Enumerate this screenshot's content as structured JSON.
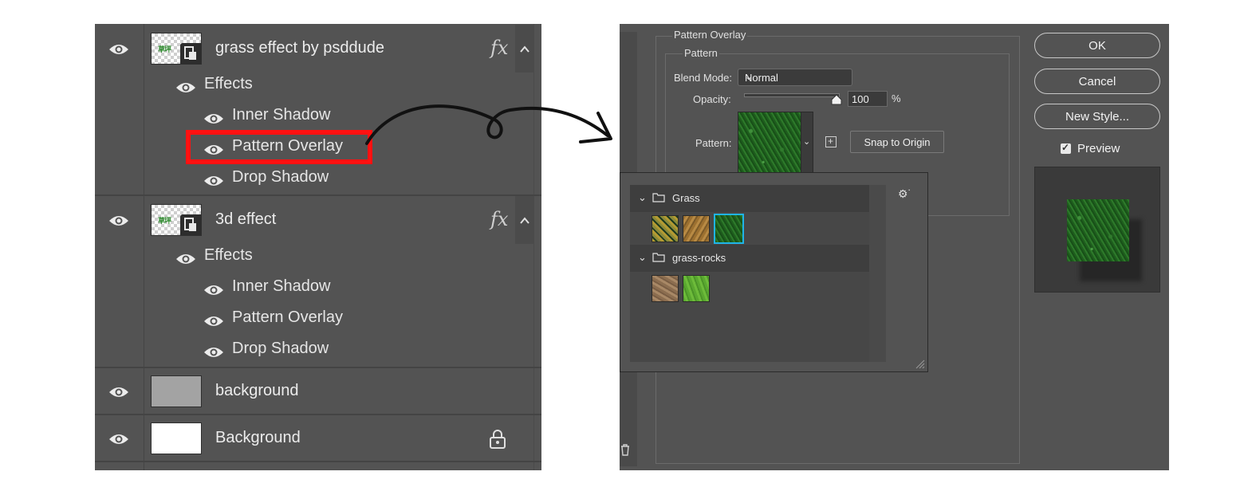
{
  "layers_panel": {
    "layers": [
      {
        "name": "grass effect by psddude",
        "thumb_text": "草坪",
        "fx_label": "fx",
        "effects_label": "Effects",
        "effects": [
          "Inner Shadow",
          "Pattern Overlay",
          "Drop Shadow"
        ]
      },
      {
        "name": "3d effect",
        "thumb_text": "草坪",
        "fx_label": "fx",
        "effects_label": "Effects",
        "effects": [
          "Inner Shadow",
          "Pattern Overlay",
          "Drop Shadow"
        ]
      },
      {
        "name": "background",
        "thumb_color": "#a3a3a3"
      },
      {
        "name": "Background",
        "thumb_color": "#ffffff",
        "locked": true
      }
    ],
    "highlight_color": "#ff1111"
  },
  "dialog": {
    "group_title": "Pattern Overlay",
    "subgroup_title": "Pattern",
    "blend_mode_label": "Blend Mode:",
    "blend_mode_value": "Normal",
    "opacity_label": "Opacity:",
    "opacity_value": "100",
    "opacity_unit": "%",
    "opacity_level": 1.0,
    "pattern_label": "Pattern:",
    "snap_button": "Snap to Origin",
    "buttons": {
      "ok": "OK",
      "cancel": "Cancel",
      "new_style": "New Style..."
    },
    "preview_label": "Preview",
    "preview_checked": true,
    "picker": {
      "groups": [
        {
          "name": "Grass",
          "swatches": [
            "t-gold",
            "t-dirt",
            "t-green"
          ],
          "selected": 2
        },
        {
          "name": "grass-rocks",
          "swatches": [
            "t-soil",
            "t-lime"
          ]
        }
      ],
      "selection_color": "#1fb4e8"
    }
  }
}
